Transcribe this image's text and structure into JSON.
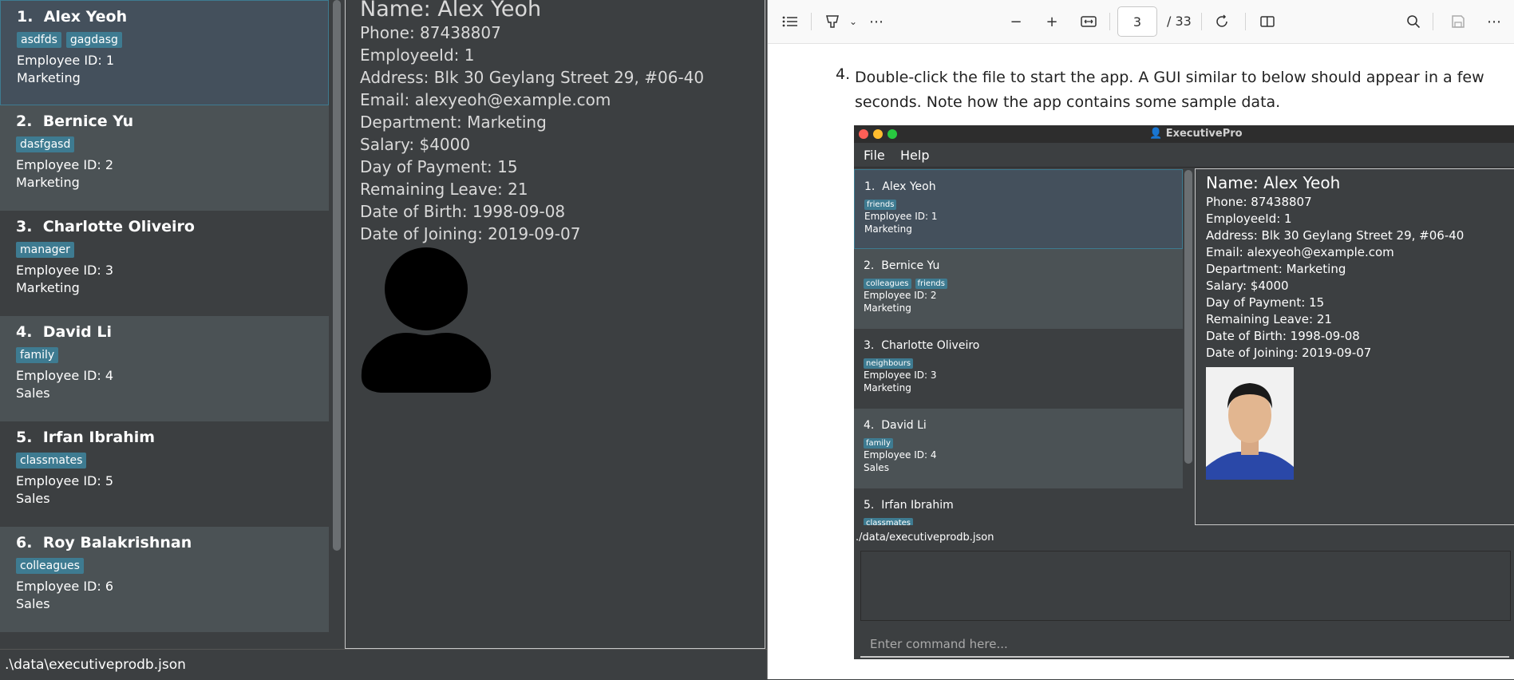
{
  "left_app": {
    "persons": [
      {
        "index": "1.",
        "name": "Alex Yeoh",
        "tags": [
          "asdfds",
          "gagdasg"
        ],
        "employee_id": "Employee ID: 1",
        "department": "Marketing"
      },
      {
        "index": "2.",
        "name": "Bernice Yu",
        "tags": [
          "dasfgasd"
        ],
        "employee_id": "Employee ID: 2",
        "department": "Marketing"
      },
      {
        "index": "3.",
        "name": "Charlotte Oliveiro",
        "tags": [
          "manager"
        ],
        "employee_id": "Employee ID: 3",
        "department": "Marketing"
      },
      {
        "index": "4.",
        "name": "David Li",
        "tags": [
          "family"
        ],
        "employee_id": "Employee ID: 4",
        "department": "Sales"
      },
      {
        "index": "5.",
        "name": "Irfan Ibrahim",
        "tags": [
          "classmates"
        ],
        "employee_id": "Employee ID: 5",
        "department": "Sales"
      },
      {
        "index": "6.",
        "name": "Roy Balakrishnan",
        "tags": [
          "colleagues"
        ],
        "employee_id": "Employee ID: 6",
        "department": "Sales"
      }
    ],
    "detail": {
      "name": "Name: Alex Yeoh",
      "lines": [
        "Phone: 87438807",
        "EmployeeId: 1",
        "Address: Blk 30 Geylang Street 29, #06-40",
        "Email: alexyeoh@example.com",
        "Department: Marketing",
        "Salary: $4000",
        "Day of Payment: 15",
        "Remaining Leave: 21",
        "Date of Birth: 1998-09-08",
        "Date of Joining: 2019-09-07"
      ]
    },
    "status": ".\\data\\executiveprodb.json"
  },
  "pdf_viewer": {
    "toolbar": {
      "page_current": "3",
      "page_total": "/ 33",
      "icons": [
        "list-icon",
        "highlight-icon",
        "chevron-down-icon",
        "more-icon",
        "zoom-out-icon",
        "zoom-in-icon",
        "fit-width-icon",
        "rotate-icon",
        "page-view-icon",
        "search-icon",
        "save-icon",
        "more-icon"
      ]
    },
    "step": {
      "number": "4.",
      "text": "Double-click the file to start the app. A GUI similar to below should appear in a few seconds. Note how the app contains some sample data."
    },
    "screenshot": {
      "title": "ExecutivePro",
      "menu": [
        "File",
        "Help"
      ],
      "persons": [
        {
          "index": "1.",
          "name": "Alex Yeoh",
          "tags": [
            "friends"
          ],
          "employee_id": "Employee ID: 1",
          "department": "Marketing"
        },
        {
          "index": "2.",
          "name": "Bernice Yu",
          "tags": [
            "colleagues",
            "friends"
          ],
          "employee_id": "Employee ID: 2",
          "department": "Marketing"
        },
        {
          "index": "3.",
          "name": "Charlotte Oliveiro",
          "tags": [
            "neighbours"
          ],
          "employee_id": "Employee ID: 3",
          "department": "Marketing"
        },
        {
          "index": "4.",
          "name": "David Li",
          "tags": [
            "family"
          ],
          "employee_id": "Employee ID: 4",
          "department": "Sales"
        },
        {
          "index": "5.",
          "name": "Irfan Ibrahim",
          "tags": [
            "classmates"
          ]
        }
      ],
      "detail": {
        "name": "Name: Alex Yeoh",
        "lines": [
          "Phone: 87438807",
          "EmployeeId: 1",
          "Address: Blk 30 Geylang Street 29, #06-40",
          "Email: alexyeoh@example.com",
          "Department: Marketing",
          "Salary: $4000",
          "Day of Payment: 15",
          "Remaining Leave: 21",
          "Date of Birth: 1998-09-08",
          "Date of Joining: 2019-09-07"
        ]
      },
      "status": "./data/executiveprodb.json",
      "command_placeholder": "Enter command here..."
    }
  },
  "colors": {
    "tag": "#3e7b91",
    "panel": "#3c3f41",
    "card_alt": "#4b5255",
    "selected": "#44505c"
  }
}
